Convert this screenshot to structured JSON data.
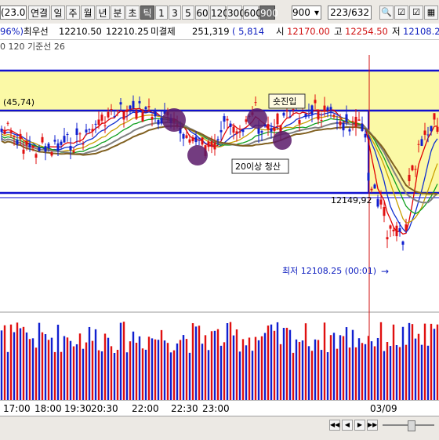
{
  "toolbar": {
    "combo_left": "(23.0",
    "buttons": [
      "연결",
      "일",
      "주",
      "월",
      "년",
      "분",
      "초",
      "틱",
      "1",
      "3",
      "5",
      "60",
      "120",
      "300",
      "600",
      "900"
    ],
    "selected": "틱",
    "tick_select": "900",
    "page_counter": "223",
    "page_total": "/632",
    "icons": [
      "search-icon",
      "checklist-icon",
      "checklist-icon",
      "grid-icon",
      "gear-icon"
    ]
  },
  "infobar": {
    "percent": "96%)",
    "label_best_bid": "최우선",
    "best_bid": "12210.50",
    "best_ask": "12210.25",
    "label_open_interest": "미결제",
    "open_interest": "251,319",
    "oi_change": "( 5,814",
    "label_open": "시",
    "open": "12170.00",
    "label_high": "고",
    "high": "12254.50",
    "label_low": "저",
    "low": "12108.25"
  },
  "indicator_bar": {
    "text": "0  120  기준선 26"
  },
  "annotations": {
    "label_a": "(45,74)",
    "label_b": "숏진입",
    "label_c": "20이상 청산",
    "label_d": "12149,92",
    "label_e": "최저 12108.25 (00:01)",
    "label_e_arrow": "→"
  },
  "time_axis": [
    "17:00",
    "18:00",
    "19:30",
    "20:30",
    "22:00",
    "22:30",
    "23:00",
    "03/09"
  ],
  "colors": {
    "band_fill": "#fbf9a6",
    "band_line": "#1010d0",
    "candle_up": "#e01010",
    "candle_down": "#1020d0",
    "vertical_marker": "#d01010",
    "marker_circle": "#5a1a6a"
  },
  "chart_data": {
    "type": "candlestick",
    "x_ticks": [
      "17:00",
      "18:00",
      "19:30",
      "20:30",
      "22:00",
      "22:30",
      "23:00",
      "03/09"
    ],
    "series_note": "",
    "key_levels": [
      12149.92,
      12108.25
    ],
    "low": 12108.25
  }
}
